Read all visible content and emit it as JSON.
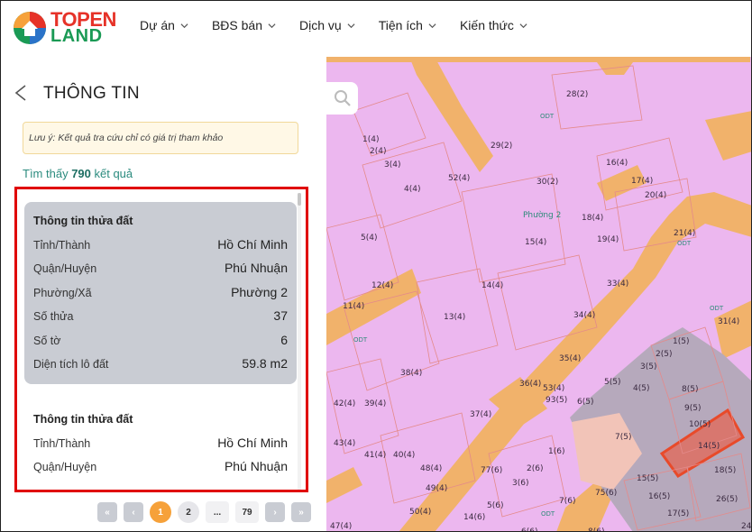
{
  "brand": {
    "top": "TOPEN",
    "bottom": "LAND"
  },
  "nav": [
    "Dự án",
    "BĐS bán",
    "Dịch vụ",
    "Tiện ích",
    "Kiến thức"
  ],
  "panel": {
    "title": "THÔNG TIN",
    "note": "Lưu ý: Kết quả tra cứu chỉ có giá trị tham khảo",
    "found_prefix": "Tìm thấy ",
    "found_count": "790",
    "found_suffix": " kết quả"
  },
  "cards": [
    {
      "title": "Thông tin thửa đất",
      "rows": [
        {
          "k": "Tỉnh/Thành",
          "v": "Hồ Chí Minh"
        },
        {
          "k": "Quận/Huyện",
          "v": "Phú Nhuận"
        },
        {
          "k": "Phường/Xã",
          "v": "Phường 2"
        },
        {
          "k": "Số thửa",
          "v": "37"
        },
        {
          "k": "Số tờ",
          "v": "6"
        },
        {
          "k": "Diện tích lô đất",
          "v": "59.8 m2"
        }
      ]
    },
    {
      "title": "Thông tin thửa đất",
      "rows": [
        {
          "k": "Tỉnh/Thành",
          "v": "Hồ Chí Minh"
        },
        {
          "k": "Quận/Huyện",
          "v": "Phú Nhuận"
        }
      ]
    }
  ],
  "pager": {
    "first": "«",
    "prev": "‹",
    "current": "1",
    "p2": "2",
    "dots": "...",
    "last": "79",
    "next": "›",
    "end": "»"
  },
  "map": {
    "ward_label": "Phường 2",
    "zone_code": "ODT",
    "parcels": [
      "28(2)",
      "ODT",
      "1(4)",
      "2(4)",
      "3(4)",
      "29(2)",
      "16(4)",
      "52(4)",
      "30(2)",
      "17(4)",
      "4(4)",
      "20(4)",
      "18(4)",
      "21(4)",
      "ODT",
      "5(4)",
      "15(4)",
      "19(4)",
      "12(4)",
      "14(4)",
      "33(4)",
      "11(4)",
      "13(4)",
      "34(4)",
      "ODT",
      "31(4)",
      "ODT",
      "35(4)",
      "1(5)",
      "38(4)",
      "2(5)",
      "3(5)",
      "36(4)",
      "53(4)",
      "93(5)",
      "5(5)",
      "4(5)",
      "8(5)",
      "42(4)",
      "39(4)",
      "6(5)",
      "9(5)",
      "37(4)",
      "10(5)",
      "43(4)",
      "7(5)",
      "14(5)",
      "41(4)",
      "40(4)",
      "1(6)",
      "48(4)",
      "77(6)",
      "2(6)",
      "18(5)",
      "15(5)",
      "49(4)",
      "3(6)",
      "75(6)",
      "16(5)",
      "26(5)",
      "5(6)",
      "7(6)",
      "50(4)",
      "14(6)",
      "ODT",
      "17(5)",
      "47(4)",
      "6(6)",
      "8(6)",
      "24(5)"
    ]
  },
  "colors": {
    "accent": "#f6a13a",
    "highlight_border": "#e00000",
    "teal": "#2b8b7e"
  }
}
